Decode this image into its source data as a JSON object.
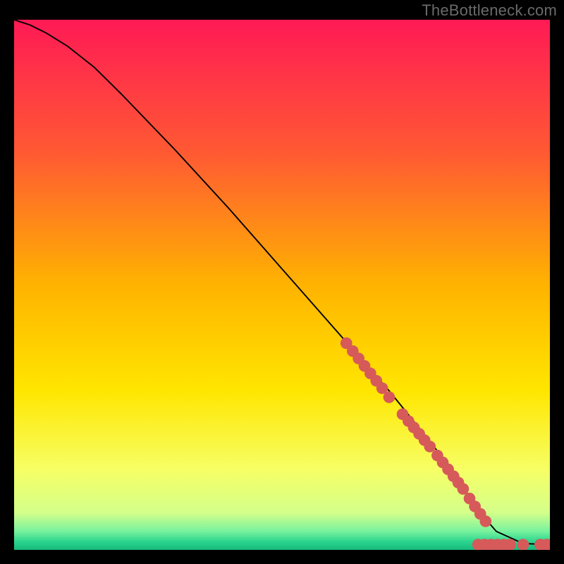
{
  "attribution": "TheBottleneck.com",
  "colors": {
    "line": "#000000",
    "dot": "#d65a5a",
    "black": "#000000",
    "gradient_stops": [
      {
        "offset": 0.0,
        "color": "#ff1a55"
      },
      {
        "offset": 0.25,
        "color": "#ff5933"
      },
      {
        "offset": 0.5,
        "color": "#ffb300"
      },
      {
        "offset": 0.7,
        "color": "#ffe600"
      },
      {
        "offset": 0.85,
        "color": "#f6ff66"
      },
      {
        "offset": 0.93,
        "color": "#d4ff8a"
      },
      {
        "offset": 0.965,
        "color": "#77f29e"
      },
      {
        "offset": 0.985,
        "color": "#29d38e"
      },
      {
        "offset": 1.0,
        "color": "#18b87c"
      }
    ]
  },
  "chart_data": {
    "type": "line",
    "title": "",
    "xlabel": "",
    "ylabel": "",
    "xlim": [
      0,
      100
    ],
    "ylim": [
      0,
      100
    ],
    "series": [
      {
        "name": "curve",
        "x": [
          0,
          3,
          6,
          10,
          15,
          20,
          30,
          40,
          50,
          60,
          70,
          78,
          82,
          85,
          87,
          90,
          95,
          100
        ],
        "y": [
          100,
          99,
          97.5,
          95,
          91,
          86,
          75.5,
          64.5,
          53,
          41.5,
          30,
          20,
          14.5,
          10,
          7,
          3.5,
          1.2,
          1.0
        ]
      }
    ],
    "dots": [
      {
        "x": 62.0,
        "y": 39.0
      },
      {
        "x": 63.2,
        "y": 37.5
      },
      {
        "x": 64.3,
        "y": 36.1
      },
      {
        "x": 65.4,
        "y": 34.7
      },
      {
        "x": 66.5,
        "y": 33.3
      },
      {
        "x": 67.6,
        "y": 31.9
      },
      {
        "x": 68.7,
        "y": 30.5
      },
      {
        "x": 70.0,
        "y": 28.8
      },
      {
        "x": 72.5,
        "y": 25.6
      },
      {
        "x": 73.6,
        "y": 24.3
      },
      {
        "x": 74.6,
        "y": 23.1
      },
      {
        "x": 75.6,
        "y": 21.9
      },
      {
        "x": 76.6,
        "y": 20.7
      },
      {
        "x": 77.6,
        "y": 19.5
      },
      {
        "x": 79.0,
        "y": 17.8
      },
      {
        "x": 80.0,
        "y": 16.5
      },
      {
        "x": 81.0,
        "y": 15.2
      },
      {
        "x": 82.0,
        "y": 13.9
      },
      {
        "x": 82.9,
        "y": 12.7
      },
      {
        "x": 83.8,
        "y": 11.5
      },
      {
        "x": 85.0,
        "y": 9.7
      },
      {
        "x": 86.0,
        "y": 8.2
      },
      {
        "x": 87.0,
        "y": 6.8
      },
      {
        "x": 88.0,
        "y": 5.4
      },
      {
        "x": 86.6,
        "y": 1.0
      },
      {
        "x": 87.8,
        "y": 1.0
      },
      {
        "x": 89.0,
        "y": 1.0
      },
      {
        "x": 90.2,
        "y": 1.0
      },
      {
        "x": 91.4,
        "y": 1.0
      },
      {
        "x": 92.6,
        "y": 1.0
      },
      {
        "x": 95.0,
        "y": 1.0
      },
      {
        "x": 98.2,
        "y": 1.0
      },
      {
        "x": 99.4,
        "y": 1.0
      }
    ],
    "dot_radius": 1.1
  }
}
